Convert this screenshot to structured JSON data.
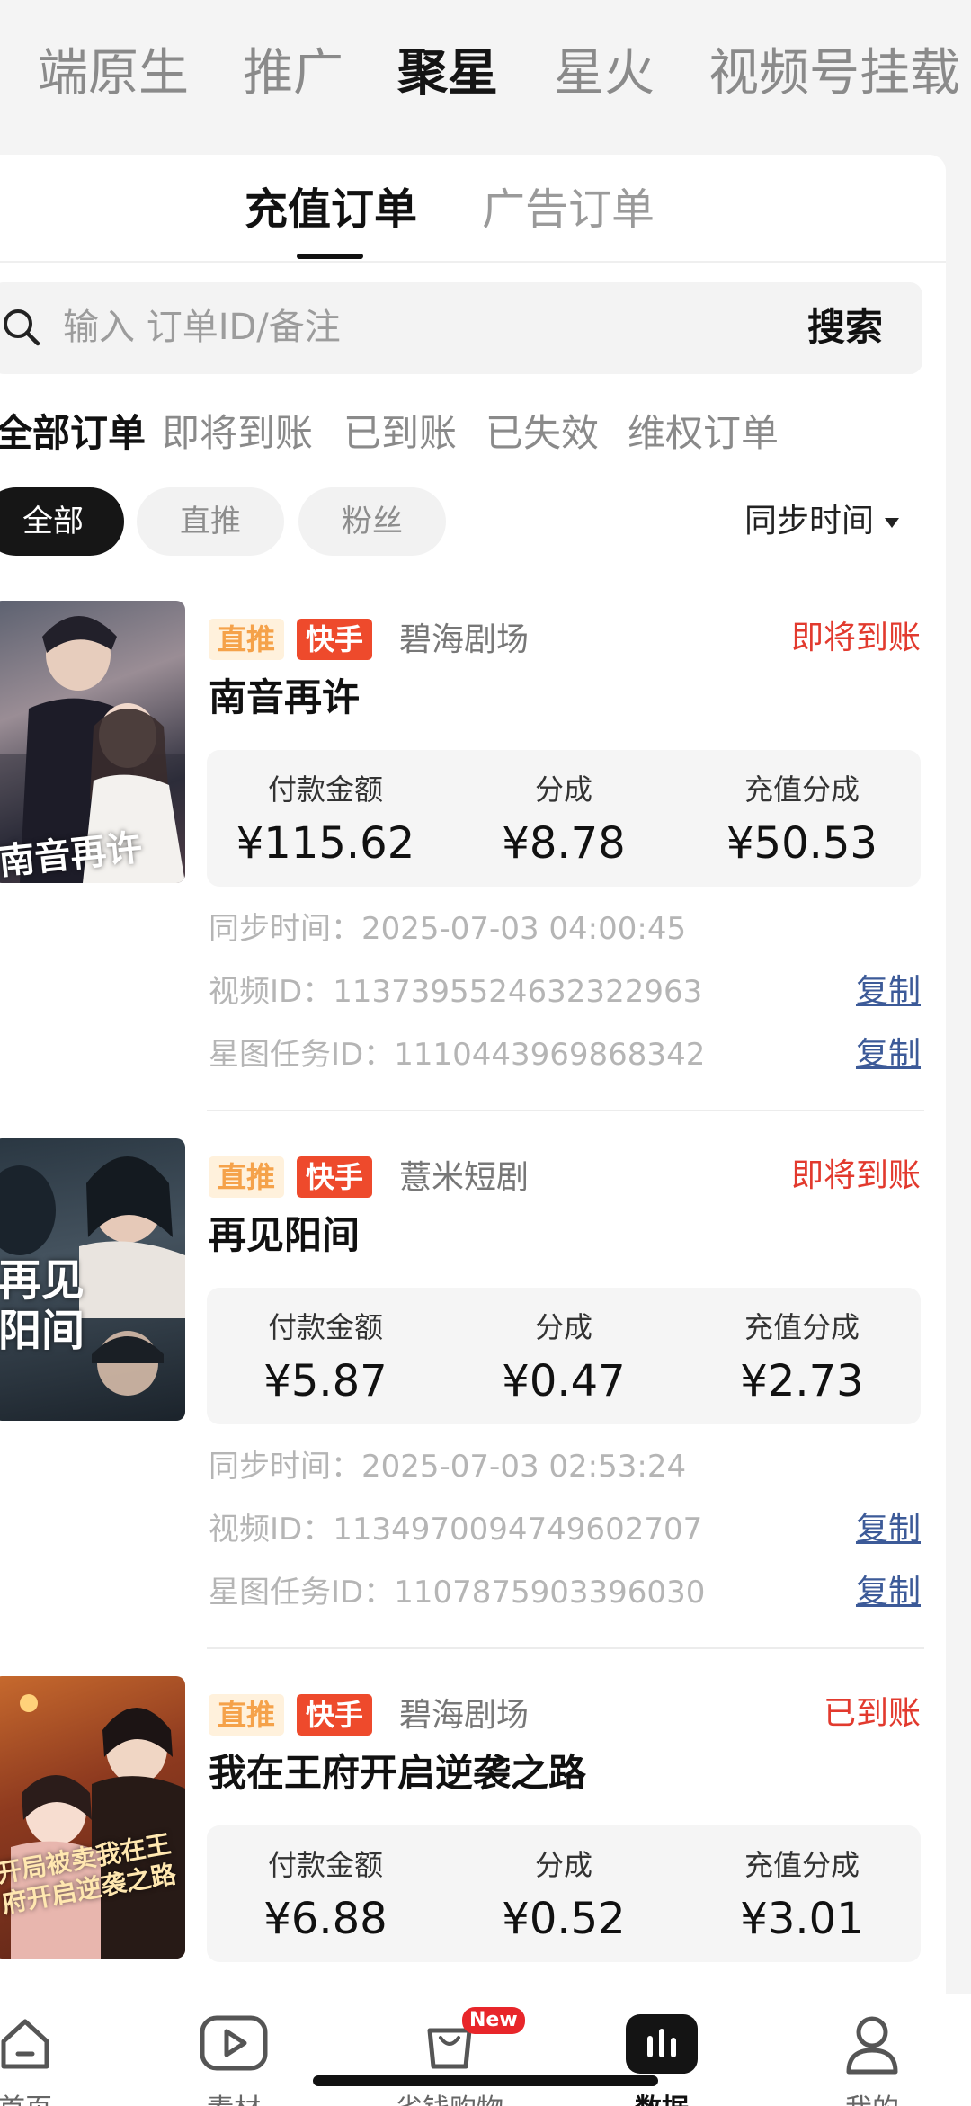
{
  "platform_tabs": [
    {
      "label": "端原生",
      "active": false
    },
    {
      "label": "推广",
      "active": false
    },
    {
      "label": "聚星",
      "active": true
    },
    {
      "label": "星火",
      "active": false
    },
    {
      "label": "视频号挂载",
      "active": false
    }
  ],
  "order_tabs": [
    {
      "label": "充值订单",
      "active": true
    },
    {
      "label": "广告订单",
      "active": false
    }
  ],
  "search": {
    "placeholder": "输入 订单ID/备注",
    "button": "搜索"
  },
  "status_filters": [
    {
      "label": "全部订单",
      "active": true
    },
    {
      "label": "即将到账",
      "active": false
    },
    {
      "label": "已到账",
      "active": false
    },
    {
      "label": "已失效",
      "active": false
    },
    {
      "label": "维权订单",
      "active": false
    }
  ],
  "source_filters": [
    {
      "label": "全部",
      "active": true
    },
    {
      "label": "直推",
      "active": false
    },
    {
      "label": "粉丝",
      "active": false
    }
  ],
  "sort_label": "同步时间",
  "stat_labels": {
    "payment": "付款金额",
    "share": "分成",
    "recharge_share": "充值分成"
  },
  "meta_labels": {
    "sync_time": "同步时间：",
    "video_id": "视频ID：",
    "task_id": "星图任务ID："
  },
  "copy_label": "复制",
  "orders": [
    {
      "tag_direct": "直推",
      "tag_platform": "快手",
      "theater": "碧海剧场",
      "status": "即将到账",
      "title": "南音再许",
      "poster_text": "南音再许",
      "payment": "¥115.62",
      "share": "¥8.78",
      "recharge_share": "¥50.53",
      "sync_time": "2025-07-03 04:00:45",
      "video_id": "1137395524632322963",
      "task_id": "1110443969868342"
    },
    {
      "tag_direct": "直推",
      "tag_platform": "快手",
      "theater": "薏米短剧",
      "status": "即将到账",
      "title": "再见阳间",
      "poster_text": "再见阳间",
      "payment": "¥5.87",
      "share": "¥0.47",
      "recharge_share": "¥2.73",
      "sync_time": "2025-07-03 02:53:24",
      "video_id": "1134970094749602707",
      "task_id": "1107875903396030"
    },
    {
      "tag_direct": "直推",
      "tag_platform": "快手",
      "theater": "碧海剧场",
      "status": "已到账",
      "title": "我在王府开启逆袭之路",
      "poster_text": "开局被卖我在王府开启逆袭之路",
      "payment": "¥6.88",
      "share": "¥0.52",
      "recharge_share": "¥3.01"
    }
  ],
  "bottom_nav": [
    {
      "label": "首页",
      "icon": "home-icon"
    },
    {
      "label": "素材",
      "icon": "video-play-icon"
    },
    {
      "label": "省钱购物",
      "icon": "shopping-bag-icon",
      "badge": "New"
    },
    {
      "label": "数据",
      "icon": "bar-chart-icon",
      "active": true
    },
    {
      "label": "我的",
      "icon": "user-icon"
    }
  ]
}
